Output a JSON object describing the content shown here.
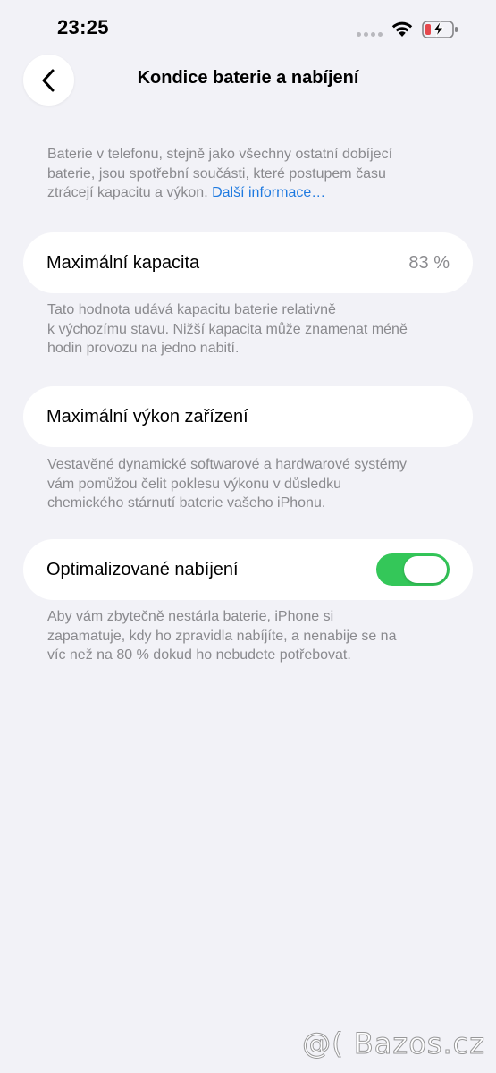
{
  "status_bar": {
    "time": "23:25"
  },
  "nav": {
    "title": "Kondice baterie a nabíjení",
    "back_icon": "chevron-left-icon"
  },
  "intro": {
    "lines": [
      "Baterie v telefonu, stejně jako všechny ostatní dobíjecí",
      "baterie, jsou spotřební součásti, které postupem času",
      "ztrácejí kapacitu a výkon."
    ],
    "link": "Další informace…"
  },
  "max_capacity": {
    "label": "Maximální kapacita",
    "value": "83 %",
    "note_lines": [
      "Tato hodnota udává kapacitu baterie relativně",
      "k výchozímu stavu. Nižší kapacita může znamenat méně",
      "hodin provozu na jedno nabití."
    ]
  },
  "max_performance": {
    "label": "Maximální výkon zařízení",
    "note_lines": [
      "Vestavěné dynamické softwarové a hardwarové systémy",
      "vám pomůžou čelit poklesu výkonu v důsledku",
      "chemického stárnutí baterie vašeho iPhonu."
    ]
  },
  "optimized_charging": {
    "label": "Optimalizované nabíjení",
    "enabled": true,
    "toggle_color": "#34c759",
    "note_lines": [
      "Aby vám zbytečně nestárla baterie, iPhone si",
      "zapamatuje, kdy ho zpravidla nabíjíte, a nenabije se na",
      "víc než na 80 % dokud ho nebudete potřebovat."
    ]
  },
  "watermark": "@( Bazos.cz",
  "colors": {
    "background": "#f2f2f7",
    "link": "#1f7ae0",
    "secondary_text": "#8a8a8e",
    "battery_low": "#e5484d"
  }
}
